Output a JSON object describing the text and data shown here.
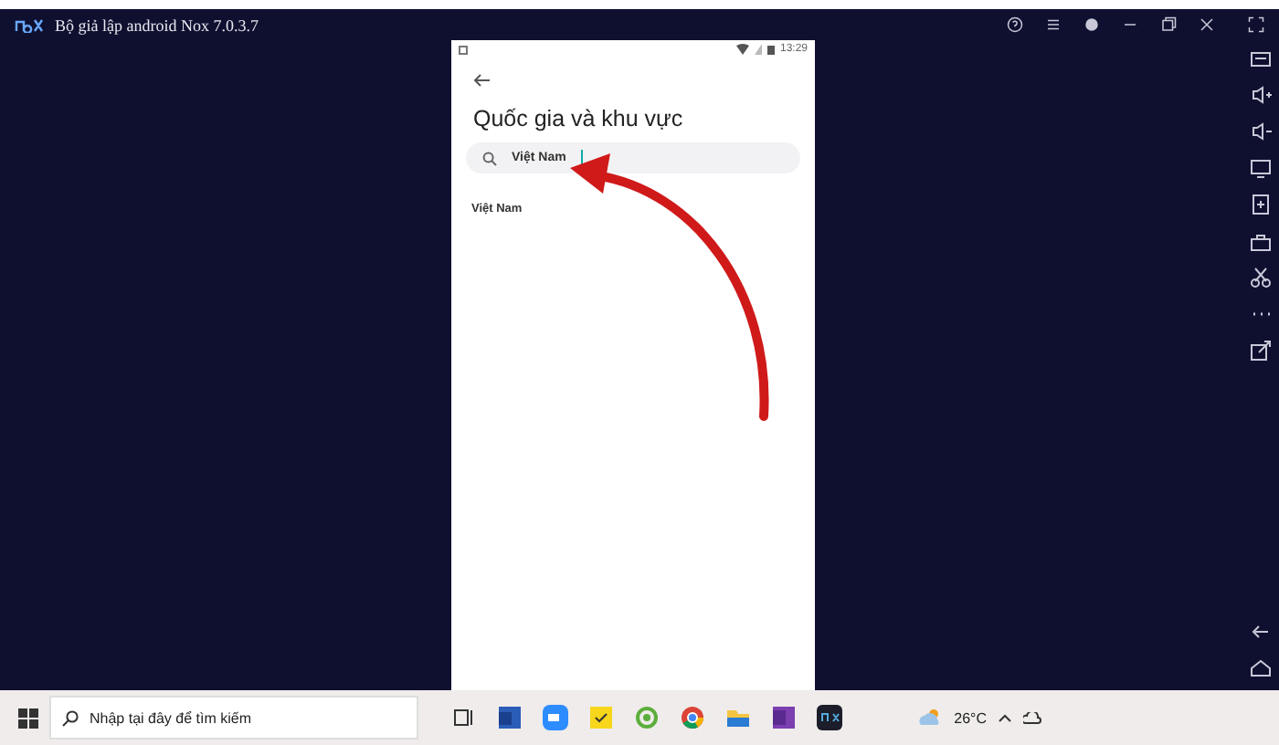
{
  "window": {
    "title": "Bộ giả lập android Nox 7.0.3.7"
  },
  "phone": {
    "time": "13:29",
    "title": "Quốc gia và khu vực",
    "search": {
      "value": "Việt Nam"
    },
    "results": [
      "Việt Nam"
    ]
  },
  "taskbar": {
    "search": {
      "placeholder": "Nhập tại đây để tìm kiếm"
    },
    "temperature": "26°C"
  }
}
